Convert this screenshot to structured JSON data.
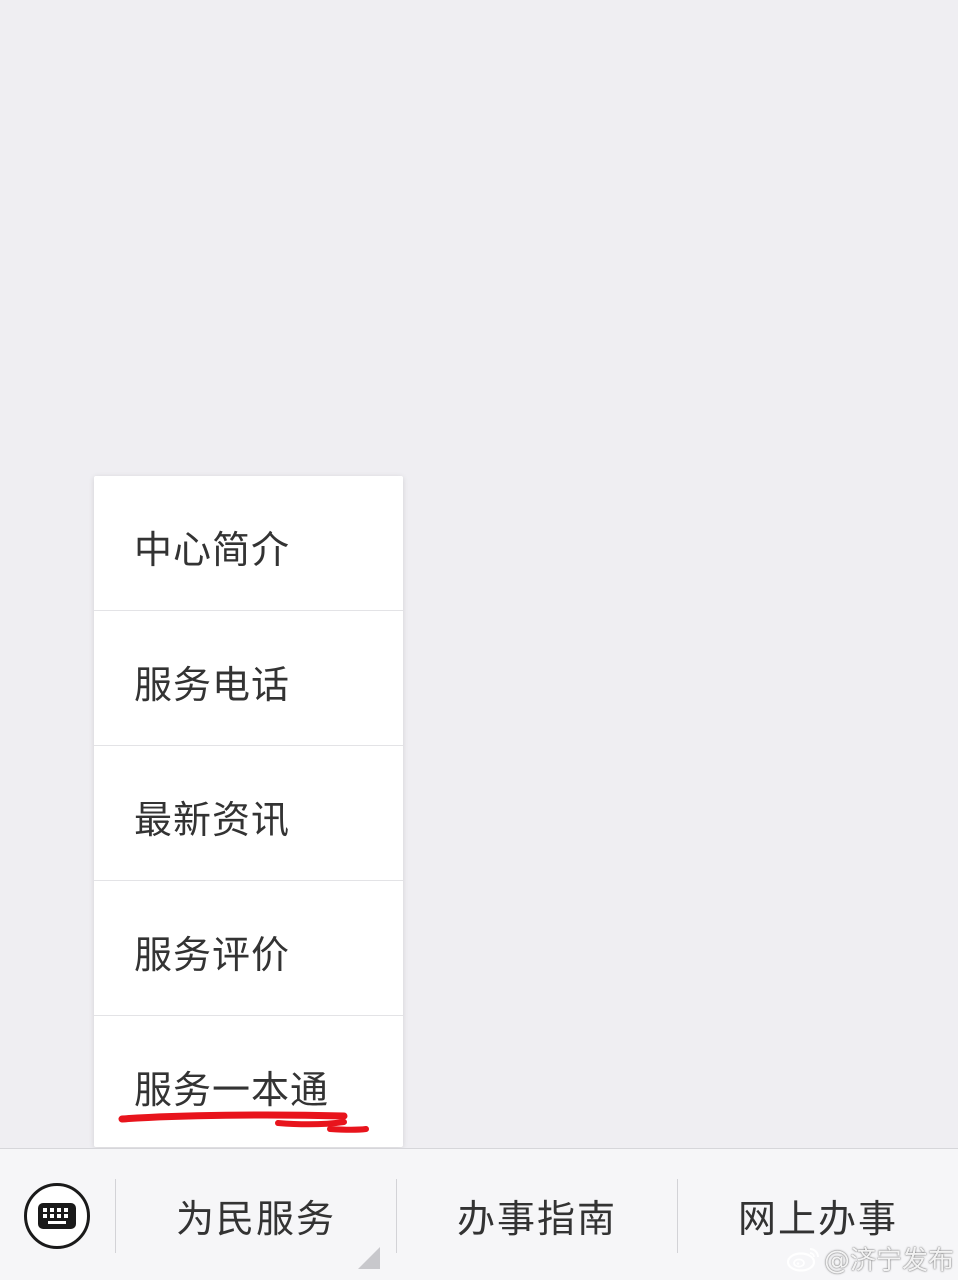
{
  "popup_menu": {
    "items": [
      {
        "label": "中心简介"
      },
      {
        "label": "服务电话"
      },
      {
        "label": "最新资讯"
      },
      {
        "label": "服务评价"
      },
      {
        "label": "服务一本通"
      }
    ],
    "highlight_color": "#e8141c"
  },
  "bottom_bar": {
    "keyboard_icon": "keyboard-icon",
    "tabs": [
      {
        "label": "为民服务",
        "has_submenu": true
      },
      {
        "label": "办事指南",
        "has_submenu": false
      },
      {
        "label": "网上办事",
        "has_submenu": false
      }
    ]
  },
  "watermark": {
    "icon": "weibo-icon",
    "text": "@济宁发布"
  },
  "colors": {
    "background": "#efeef2",
    "menu_background": "#ffffff",
    "text": "#333333",
    "annotation_red": "#e8141c"
  }
}
